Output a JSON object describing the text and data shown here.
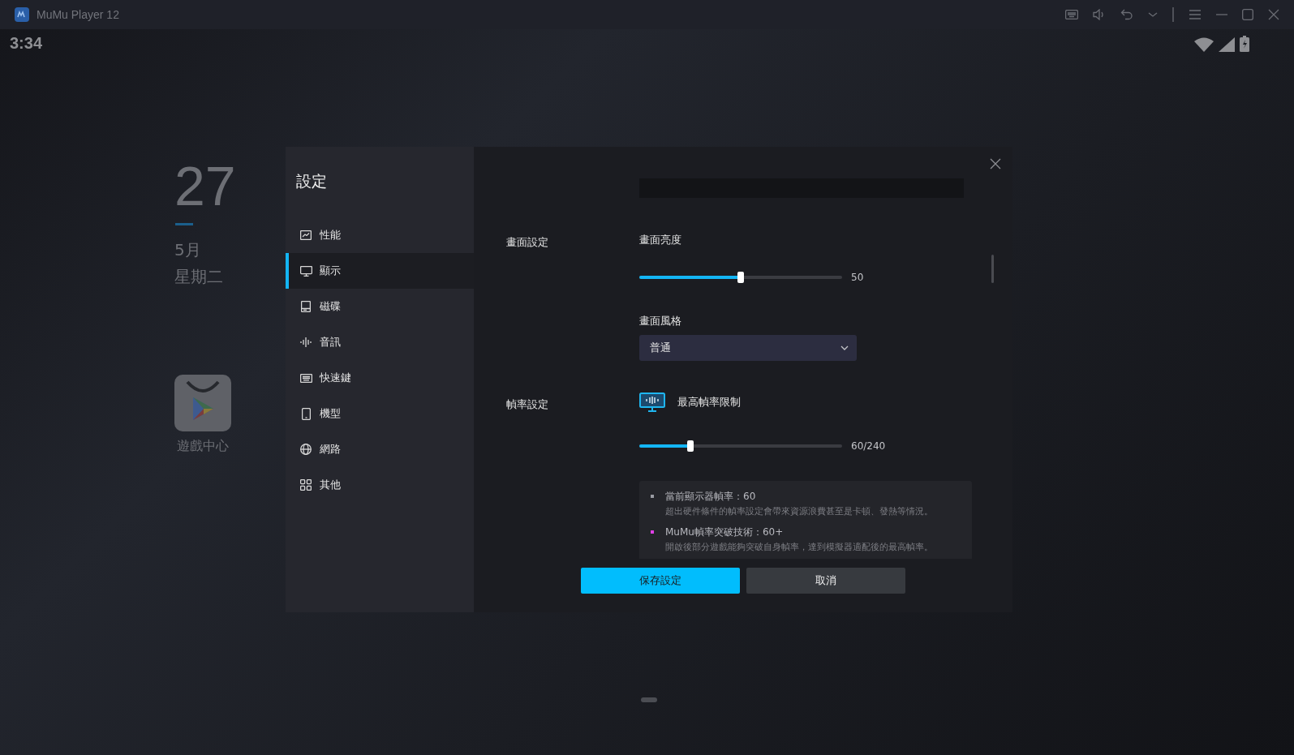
{
  "window": {
    "title": "MuMu Player 12"
  },
  "status_bar": {
    "time": "3:34"
  },
  "home": {
    "day": "27",
    "month": "5月",
    "weekday": "星期二",
    "apps": [
      {
        "label": "遊戲中心"
      }
    ]
  },
  "dialog": {
    "title": "設定",
    "sidebar": {
      "items": [
        {
          "label": "性能",
          "selected": false
        },
        {
          "label": "顯示",
          "selected": true
        },
        {
          "label": "磁碟",
          "selected": false
        },
        {
          "label": "音訊",
          "selected": false
        },
        {
          "label": "快速鍵",
          "selected": false
        },
        {
          "label": "機型",
          "selected": false
        },
        {
          "label": "網路",
          "selected": false
        },
        {
          "label": "其他",
          "selected": false
        }
      ]
    },
    "sections": [
      {
        "label": "畫面設定",
        "settings": [
          {
            "kind": "slider",
            "label": "畫面亮度",
            "level": 0.5,
            "reading": "50"
          },
          {
            "kind": "dropdown",
            "label": "畫面風格",
            "value": "普通"
          }
        ]
      },
      {
        "label": "幀率設定",
        "settings": [
          {
            "kind": "slider",
            "label": "最高幀率限制",
            "level": 0.25,
            "reading": "60/240",
            "icon": true
          }
        ],
        "notes": [
          {
            "title": "當前顯示器幀率：60",
            "text": "超出硬件條件的幀率設定會帶來資源浪費甚至是卡頓、發熱等情況。",
            "color": "#9a9ca3"
          },
          {
            "title": "MuMu幀率突破技術：60+",
            "text": "開啟後部分遊戲能夠突破自身幀率，達到模擬器適配後的最高幀率。",
            "color": "#e040e6"
          }
        ]
      }
    ],
    "buttons": [
      {
        "label": "保存設定",
        "kind": "primary"
      },
      {
        "label": "取消",
        "kind": "secondary"
      }
    ]
  }
}
